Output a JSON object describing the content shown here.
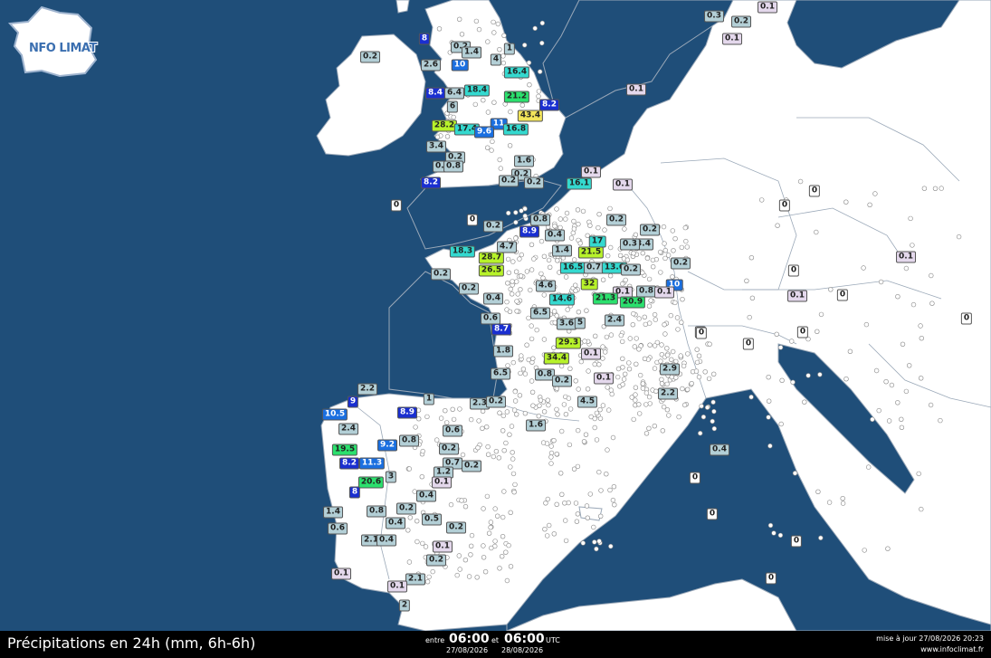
{
  "logo": {
    "text": "NFO",
    "text2": "LIMAT"
  },
  "footer": {
    "title": "Précipitations en 24h (mm, 6h-6h)",
    "between": "entre",
    "start_time": "06:00",
    "and": "et",
    "end_time": "06:00",
    "utc": "UTC",
    "start_date": "27/08/2026",
    "end_date": "28/08/2026",
    "updated": "mise à jour 27/08/2026 20:23",
    "site": "www.infoclimat.fr"
  },
  "colors": {
    "sea": "#1f4e79",
    "land": "#ffffff",
    "border": "#9aa8b8",
    "zero": "#ffffff",
    "trace": "#e4d8ec",
    "low": "#b3cfd6",
    "mid": "#34d9cf",
    "high": "#2be06d",
    "vhigh": "#b7f22a",
    "extreme": "#f2e45a",
    "blue": "#1a6fe0",
    "darkblue": "#1a2fd0"
  },
  "stations": [
    {
      "v": "0.1",
      "c": "trace"
    },
    {
      "v": "0.3",
      "c": "low"
    },
    {
      "v": "0.2",
      "c": "low"
    },
    {
      "v": "0.1",
      "c": "trace"
    },
    {
      "v": "8",
      "c": "darkblue"
    },
    {
      "v": "0.2",
      "c": "low"
    },
    {
      "v": "1",
      "c": "low"
    },
    {
      "v": "1.4",
      "c": "low"
    },
    {
      "v": "0.2",
      "c": "low"
    },
    {
      "v": "2.6",
      "c": "low"
    },
    {
      "v": "10",
      "c": "blue"
    },
    {
      "v": "4",
      "c": "low"
    },
    {
      "v": "16.4",
      "c": "mid"
    },
    {
      "v": "0.1",
      "c": "trace"
    },
    {
      "v": "8.4",
      "c": "darkblue"
    },
    {
      "v": "6.4",
      "c": "low"
    },
    {
      "v": "18.4",
      "c": "mid"
    },
    {
      "v": "21.2",
      "c": "high"
    },
    {
      "v": "8.2",
      "c": "darkblue"
    },
    {
      "v": "6",
      "c": "low"
    },
    {
      "v": "43.4",
      "c": "extreme"
    },
    {
      "v": "28.2",
      "c": "vhigh"
    },
    {
      "v": "17.4",
      "c": "mid"
    },
    {
      "v": "11",
      "c": "blue"
    },
    {
      "v": "9.6",
      "c": "blue"
    },
    {
      "v": "16.8",
      "c": "mid"
    },
    {
      "v": "3.4",
      "c": "low"
    },
    {
      "v": "0.2",
      "c": "low"
    },
    {
      "v": "1.6",
      "c": "low"
    },
    {
      "v": "0.4",
      "c": "low"
    },
    {
      "v": "0.8",
      "c": "low"
    },
    {
      "v": "0.1",
      "c": "trace"
    },
    {
      "v": "0.2",
      "c": "low"
    },
    {
      "v": "0.2",
      "c": "low"
    },
    {
      "v": "8.2",
      "c": "darkblue"
    },
    {
      "v": "0.2",
      "c": "low"
    },
    {
      "v": "16.1",
      "c": "mid"
    },
    {
      "v": "0.1",
      "c": "trace"
    },
    {
      "v": "0",
      "c": "zero"
    },
    {
      "v": "0",
      "c": "zero"
    },
    {
      "v": "0.2",
      "c": "low"
    },
    {
      "v": "0.8",
      "c": "low"
    },
    {
      "v": "8.9",
      "c": "darkblue"
    },
    {
      "v": "0.4",
      "c": "low"
    },
    {
      "v": "4.7",
      "c": "low"
    },
    {
      "v": "17",
      "c": "mid"
    },
    {
      "v": "0.2",
      "c": "low"
    },
    {
      "v": "0.2",
      "c": "low"
    },
    {
      "v": "3.4",
      "c": "low"
    },
    {
      "v": "18.3",
      "c": "mid"
    },
    {
      "v": "28.7",
      "c": "vhigh"
    },
    {
      "v": "21.5",
      "c": "vhigh"
    },
    {
      "v": "1.4",
      "c": "low"
    },
    {
      "v": "0.3",
      "c": "low"
    },
    {
      "v": "26.5",
      "c": "vhigh"
    },
    {
      "v": "16.5",
      "c": "mid"
    },
    {
      "v": "0.7",
      "c": "low"
    },
    {
      "v": "13.6",
      "c": "mid"
    },
    {
      "v": "0.2",
      "c": "low"
    },
    {
      "v": "0.2",
      "c": "low"
    },
    {
      "v": "0.2",
      "c": "low"
    },
    {
      "v": "4.6",
      "c": "low"
    },
    {
      "v": "32",
      "c": "vhigh"
    },
    {
      "v": "0.1",
      "c": "trace"
    },
    {
      "v": "0.8",
      "c": "low"
    },
    {
      "v": "10",
      "c": "blue"
    },
    {
      "v": "0.2",
      "c": "low"
    },
    {
      "v": "14.6",
      "c": "mid"
    },
    {
      "v": "21.3",
      "c": "high"
    },
    {
      "v": "20.9",
      "c": "high"
    },
    {
      "v": "0.1",
      "c": "trace"
    },
    {
      "v": "0.4",
      "c": "low"
    },
    {
      "v": "6.5",
      "c": "low"
    },
    {
      "v": "0.6",
      "c": "low"
    },
    {
      "v": "3.6",
      "c": "low"
    },
    {
      "v": "5",
      "c": "low"
    },
    {
      "v": "2.4",
      "c": "low"
    },
    {
      "v": "8.7",
      "c": "darkblue"
    },
    {
      "v": "1.8",
      "c": "low"
    },
    {
      "v": "29.3",
      "c": "vhigh"
    },
    {
      "v": "34.4",
      "c": "vhigh"
    },
    {
      "v": "0.1",
      "c": "trace"
    },
    {
      "v": "0.8",
      "c": "low"
    },
    {
      "v": "6.5",
      "c": "low"
    },
    {
      "v": "0.2",
      "c": "low"
    },
    {
      "v": "0.1",
      "c": "trace"
    },
    {
      "v": "2.9",
      "c": "low"
    },
    {
      "v": "2.2",
      "c": "low"
    },
    {
      "v": "4.5",
      "c": "low"
    },
    {
      "v": "2.3",
      "c": "low"
    },
    {
      "v": "0.2",
      "c": "low"
    },
    {
      "v": "1.6",
      "c": "low"
    },
    {
      "v": "2.2",
      "c": "low"
    },
    {
      "v": "9",
      "c": "darkblue"
    },
    {
      "v": "1",
      "c": "low"
    },
    {
      "v": "10.5",
      "c": "blue"
    },
    {
      "v": "8.9",
      "c": "darkblue"
    },
    {
      "v": "2.4",
      "c": "low"
    },
    {
      "v": "0.6",
      "c": "low"
    },
    {
      "v": "19.5",
      "c": "high"
    },
    {
      "v": "9.2",
      "c": "blue"
    },
    {
      "v": "0.8",
      "c": "low"
    },
    {
      "v": "8.2",
      "c": "darkblue"
    },
    {
      "v": "11.3",
      "c": "blue"
    },
    {
      "v": "0.2",
      "c": "low"
    },
    {
      "v": "3",
      "c": "low"
    },
    {
      "v": "20.6",
      "c": "high"
    },
    {
      "v": "0.7",
      "c": "low"
    },
    {
      "v": "0.2",
      "c": "low"
    },
    {
      "v": "1.2",
      "c": "low"
    },
    {
      "v": "0.1",
      "c": "trace"
    },
    {
      "v": "8",
      "c": "darkblue"
    },
    {
      "v": "0.4",
      "c": "low"
    },
    {
      "v": "1.4",
      "c": "low"
    },
    {
      "v": "0.8",
      "c": "low"
    },
    {
      "v": "0.2",
      "c": "low"
    },
    {
      "v": "0.4",
      "c": "low"
    },
    {
      "v": "0.5",
      "c": "low"
    },
    {
      "v": "0.6",
      "c": "low"
    },
    {
      "v": "0.2",
      "c": "low"
    },
    {
      "v": "2.1",
      "c": "low"
    },
    {
      "v": "0.4",
      "c": "low"
    },
    {
      "v": "0.1",
      "c": "trace"
    },
    {
      "v": "0.2",
      "c": "low"
    },
    {
      "v": "0.1",
      "c": "trace"
    },
    {
      "v": "2.1",
      "c": "low"
    },
    {
      "v": "0.1",
      "c": "trace"
    },
    {
      "v": "2",
      "c": "low"
    },
    {
      "v": "0.4",
      "c": "low"
    },
    {
      "v": "0",
      "c": "zero"
    },
    {
      "v": "0",
      "c": "zero"
    },
    {
      "v": "0",
      "c": "zero"
    },
    {
      "v": "0.1",
      "c": "trace"
    },
    {
      "v": "0",
      "c": "zero"
    },
    {
      "v": "0.1",
      "c": "trace"
    },
    {
      "v": "0",
      "c": "zero"
    },
    {
      "v": "0",
      "c": "zero"
    },
    {
      "v": "0",
      "c": "zero"
    },
    {
      "v": "0",
      "c": "zero"
    },
    {
      "v": "0",
      "c": "zero"
    },
    {
      "v": "0",
      "c": "zero"
    },
    {
      "v": "0",
      "c": "zero"
    },
    {
      "v": "0",
      "c": "zero"
    },
    {
      "v": "0",
      "c": "zero"
    },
    {
      "v": "0",
      "c": "zero"
    },
    {
      "v": "0",
      "c": "zero"
    },
    {
      "v": "0",
      "c": "zero"
    },
    {
      "v": "0",
      "c": "zero"
    }
  ]
}
